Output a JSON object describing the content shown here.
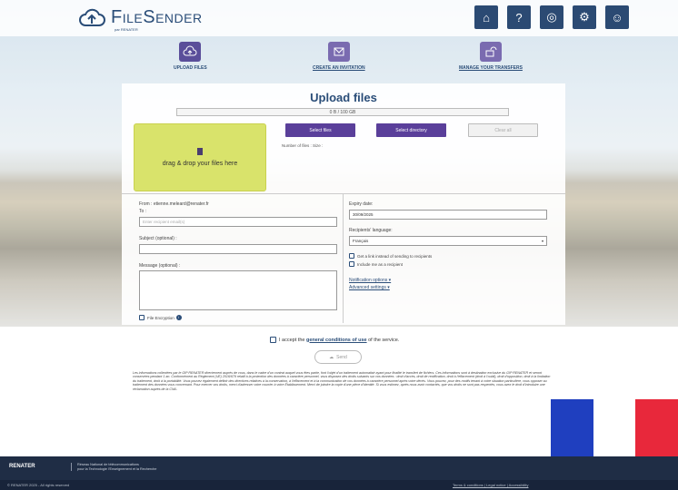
{
  "brand": {
    "name": "FileSender",
    "sub": "par RENATER"
  },
  "header_icons": [
    "home-icon",
    "help-icon",
    "language-icon",
    "user-admin-icon",
    "user-profile-icon"
  ],
  "nav": {
    "upload": "UPLOAD FILES",
    "invitation": "CREATE AN INVITATION",
    "transfers": "MANAGE YOUR TRANSFERS"
  },
  "panel": {
    "title": "Upload files",
    "progress": "0 B / 100 GB",
    "drop_text": "drag & drop your files here",
    "select_files": "Select files",
    "select_directory": "Select directory",
    "clear_all": "Clear all",
    "number_of_files": "Number of files :  Size :"
  },
  "form": {
    "from": "From : etienne.meleard@renater.fr",
    "to_label": "To :",
    "to_placeholder": "Enter recipient email(s)",
    "subject_label": "Subject (optional) :",
    "message_label": "Message (optional) :",
    "file_encryption": "File Encryption",
    "expiry_label": "Expiry date:",
    "expiry_value": "30/09/2025",
    "language_label": "Recipients' language:",
    "language_value": "Français",
    "get_link": "Get a link instead of sending to recipients",
    "include_me": "Include me as a recipient",
    "notification_options": "Notification options ▾",
    "advanced_settings": "Advanced settings ▾"
  },
  "terms": {
    "prefix": "I accept the ",
    "link": "general conditions of use",
    "suffix": " of the service."
  },
  "send_label": "Send",
  "legal_text": "Les informations collectées par le GIP RENATER directement auprès de vous, dans le cadre d'un contrat auquel vous êtes partie, font l'objet d'un traitement automatisé ayant pour finalité le transfert de fichiers. Ces informations sont à destination exclusive du GIP RENATER et seront conservées pendant 1 an. Conformément au Règlement (UE) 2016/679 relatif à la protection des données à caractère personnel, vous disposez des droits suivants sur vos données : droit d'accès, droit de rectification, droit à l'effacement (droit à l'oubli), droit d'opposition, droit à la limitation du traitement, droit à la portabilité. Vous pouvez également définir des directives relatives à la conservation, à l'effacement et à la communication de vos données à caractère personnel après votre décès. Vous pouvez, pour des motifs tenant à votre situation particulière, vous opposer au traitement des données vous concernant. Pour exercer vos droits, merci d'adresser votre courrier à votre Établissement. Merci de joindre la copie d'une pièce d'identité. Si vous estimez, après nous avoir contactés, que vos droits ne sont pas respectés, vous avez le droit d'introduire une réclamation auprès de la CNIL.",
  "footer": {
    "logo": "RENATER",
    "desc_line1": "Réseau National de télécommunications",
    "desc_line2": "pour la Technologie l'Enseignement et la Recherche",
    "copyright": "© RENATER 2025 - All rights reserved",
    "links": "Terms & conditions | Legal notice | Accessibility"
  },
  "colors": {
    "brand": "#2a4d78",
    "accent_purple": "#5a3f9a",
    "drop_zone": "#d9e36b",
    "footer": "#1f2d45"
  }
}
